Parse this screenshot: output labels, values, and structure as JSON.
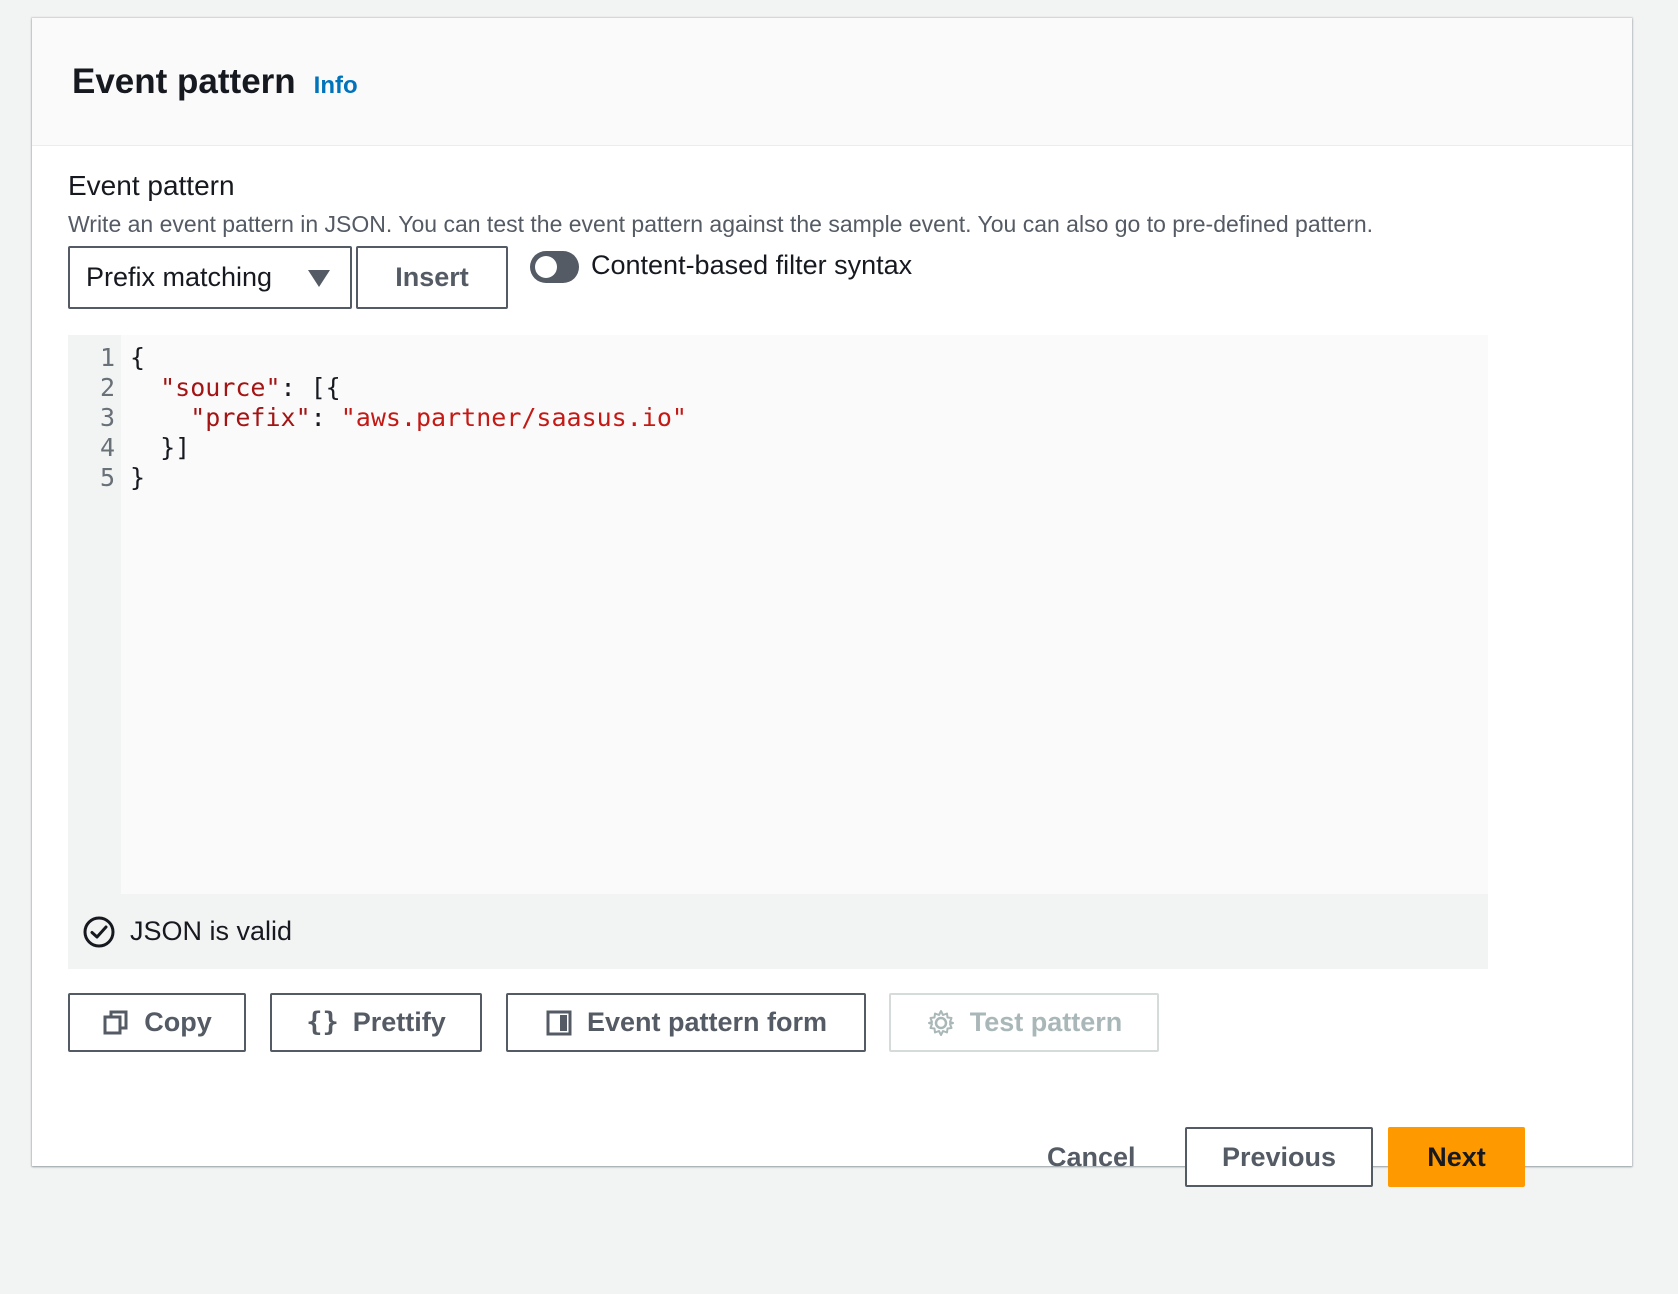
{
  "panel": {
    "title": "Event pattern",
    "info_label": "Info"
  },
  "field": {
    "label": "Event pattern",
    "description": "Write an event pattern in JSON. You can test the event pattern against the sample event. You can also go to pre-defined pattern."
  },
  "controls": {
    "select_value": "Prefix matching",
    "insert_label": "Insert",
    "toggle_label": "Content-based filter syntax",
    "toggle_on": false
  },
  "editor": {
    "line_numbers": [
      "1",
      "2",
      "3",
      "4",
      "5"
    ],
    "lines": {
      "l1": "{",
      "l2_indent": "  ",
      "l2_key": "\"source\"",
      "l2_rest": ": [{",
      "l3_indent": "    ",
      "l3_key": "\"prefix\"",
      "l3_sep": ": ",
      "l3_value": "\"aws.partner/saasus.io\"",
      "l4": "  }]",
      "l5": "}"
    },
    "status": "JSON is valid"
  },
  "actions": {
    "copy": "Copy",
    "prettify": "Prettify",
    "pattern_form": "Event pattern form",
    "test_pattern": "Test pattern"
  },
  "footer": {
    "cancel": "Cancel",
    "previous": "Previous",
    "next": "Next"
  },
  "colors": {
    "accent": "#0073bb",
    "primary_button": "#ff9900",
    "json_key": "#a31515",
    "json_string": "#c41a16"
  },
  "icons": {
    "status": "check-circle-icon",
    "copy": "copy-icon",
    "prettify": "braces-icon",
    "pattern_form": "split-panel-icon",
    "test": "gear-icon",
    "dropdown": "caret-down-icon"
  }
}
